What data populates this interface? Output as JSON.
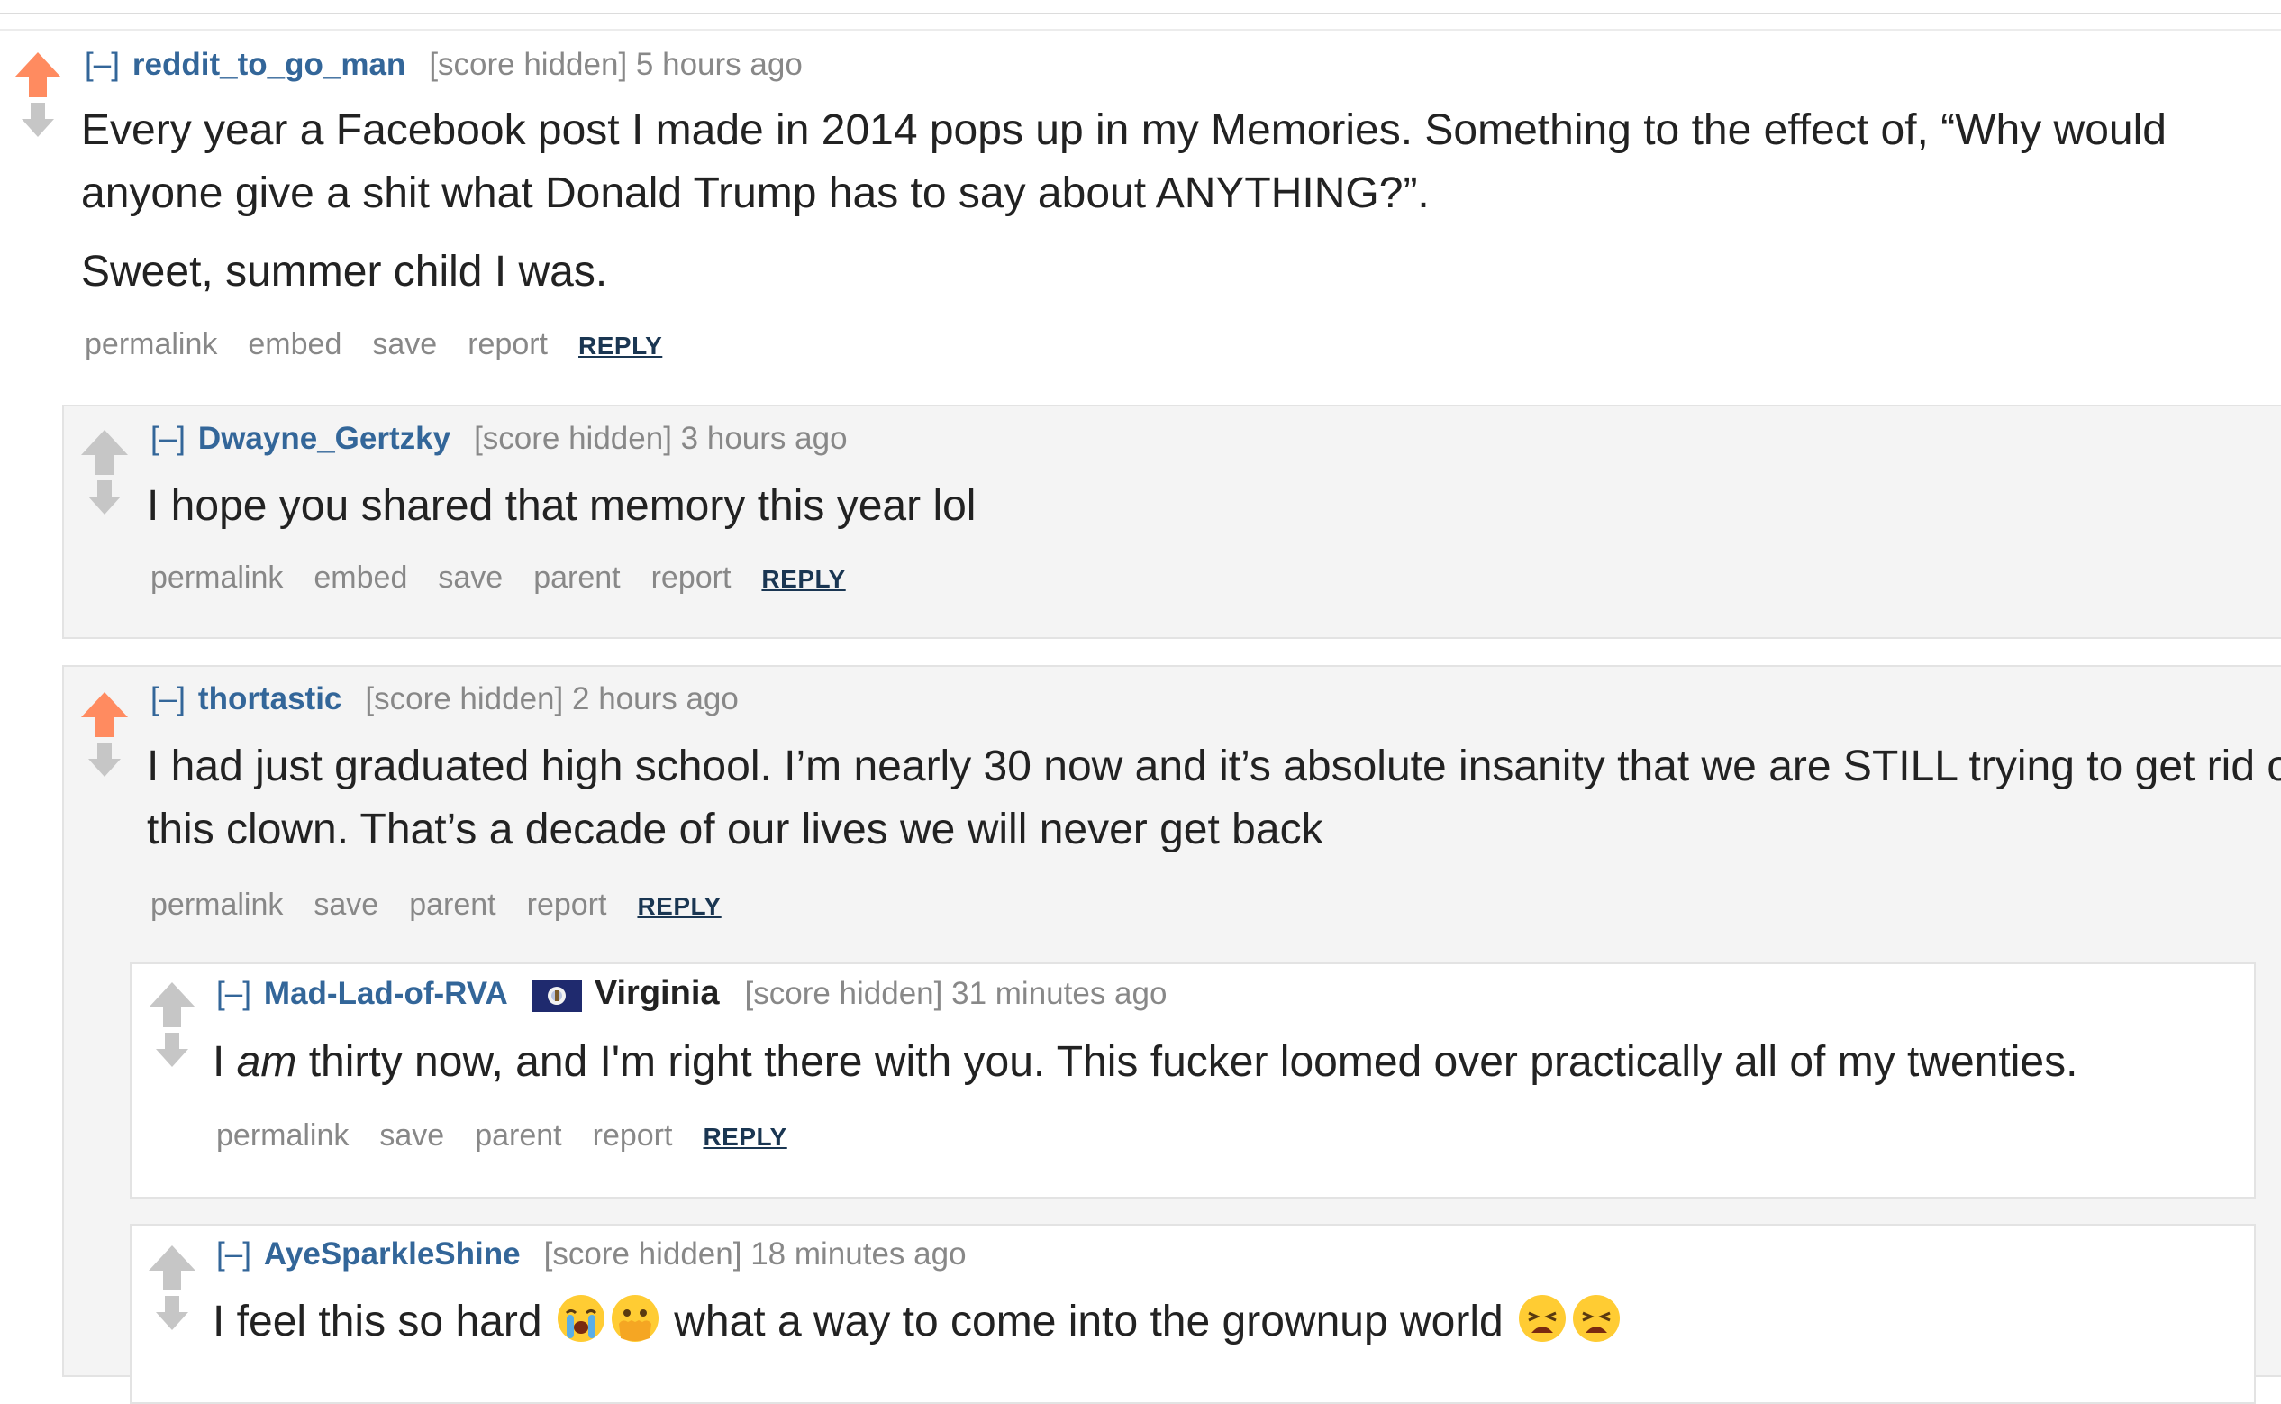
{
  "comments": [
    {
      "toggle": "[–]",
      "author": "reddit_to_go_man",
      "score": "[score hidden]",
      "time": "5 hours ago",
      "upvoted": true,
      "paragraphs": [
        "Every year a Facebook post I made in 2014 pops up in my Memories. Something to the effect of, “Why would anyone give a shit what Donald Trump has to say about ANYTHING?”.",
        "Sweet, summer child I was."
      ],
      "buttons": [
        "permalink",
        "embed",
        "save",
        "report"
      ],
      "reply": "REPLY"
    },
    {
      "toggle": "[–]",
      "author": "Dwayne_Gertzky",
      "score": "[score hidden]",
      "time": "3 hours ago",
      "upvoted": false,
      "paragraphs": [
        "I hope you shared that memory this year lol"
      ],
      "buttons": [
        "permalink",
        "embed",
        "save",
        "parent",
        "report"
      ],
      "reply": "REPLY"
    },
    {
      "toggle": "[–]",
      "author": "thortastic",
      "score": "[score hidden]",
      "time": "2 hours ago",
      "upvoted": true,
      "paragraphs": [
        "I had just graduated high school. I’m nearly 30 now and it’s absolute insanity that we are STILL trying to get rid of this clown. That’s a decade of our lives we will never get back"
      ],
      "buttons": [
        "permalink",
        "save",
        "parent",
        "report"
      ],
      "reply": "REPLY"
    },
    {
      "toggle": "[–]",
      "author": "Mad-Lad-of-RVA",
      "flair": "Virginia",
      "score": "[score hidden]",
      "time": "31 minutes ago",
      "upvoted": false,
      "body_parts": [
        "I ",
        "am",
        " thirty now, and I'm right there with you. This fucker loomed over practically all of my twenties."
      ],
      "buttons": [
        "permalink",
        "save",
        "parent",
        "report"
      ],
      "reply": "REPLY"
    },
    {
      "toggle": "[–]",
      "author": "AyeSparkleShine",
      "score": "[score hidden]",
      "time": "18 minutes ago",
      "upvoted": false,
      "body_parts": [
        "I feel this so hard ",
        " what a way to come into the grownup world "
      ],
      "emoji": [
        "loudly-crying-face",
        "face-with-open-eyes-and-hand-over-mouth",
        "weary-face",
        "weary-face"
      ]
    }
  ],
  "colors": {
    "upvote": "#ff8b60",
    "neutral_arrow": "#c6c6c6",
    "author": "#336699",
    "meta": "#888888",
    "reply": "#1a3652",
    "odd_bg": "#f4f4f4"
  }
}
